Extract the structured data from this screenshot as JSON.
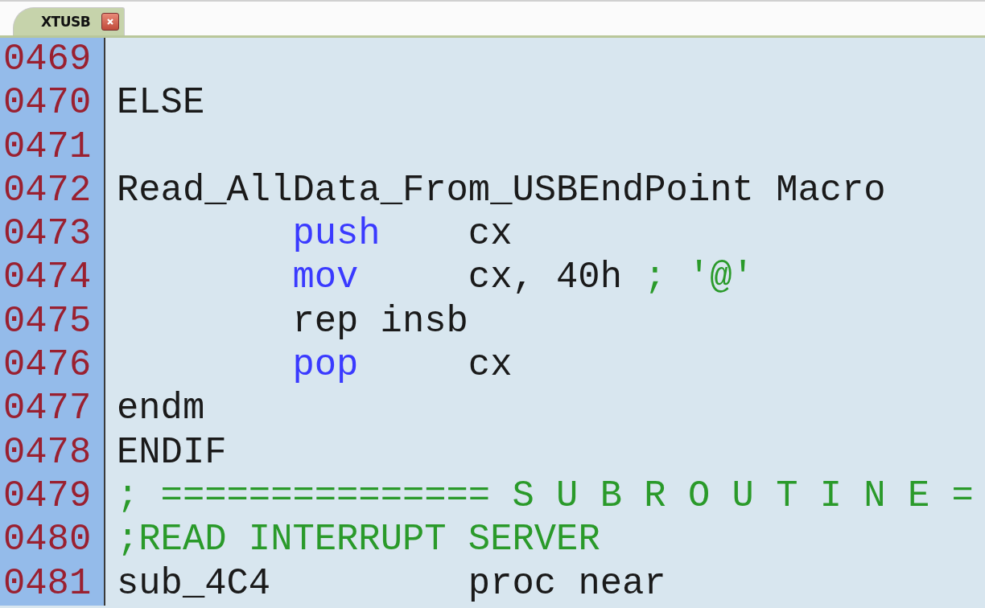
{
  "tabs": [
    {
      "label": "XTUSB",
      "selected": true
    }
  ],
  "lines": [
    {
      "number": "0469"
    },
    {
      "number": "0470",
      "indented": false,
      "segments": [
        {
          "kind": "plain",
          "text": "ELSE"
        }
      ]
    },
    {
      "number": "0471"
    },
    {
      "number": "0472",
      "indented": false,
      "segments": [
        {
          "kind": "plain",
          "text": "Read_AllData_From_USBEndPoint Macro"
        }
      ]
    },
    {
      "number": "0473",
      "indented": true,
      "segments": [
        {
          "kind": "keyword",
          "text": "push"
        },
        {
          "kind": "plain",
          "text": "    cx"
        }
      ]
    },
    {
      "number": "0474",
      "indented": true,
      "segments": [
        {
          "kind": "keyword",
          "text": "mov"
        },
        {
          "kind": "plain",
          "text": "     cx, 40h "
        },
        {
          "kind": "comment",
          "text": "; '@'"
        }
      ]
    },
    {
      "number": "0475",
      "indented": true,
      "segments": [
        {
          "kind": "plain",
          "text": "rep insb"
        }
      ]
    },
    {
      "number": "0476",
      "indented": true,
      "segments": [
        {
          "kind": "keyword",
          "text": "pop"
        },
        {
          "kind": "plain",
          "text": "     cx"
        }
      ]
    },
    {
      "number": "0477",
      "indented": false,
      "segments": [
        {
          "kind": "plain",
          "text": "endm"
        }
      ]
    },
    {
      "number": "0478",
      "indented": false,
      "segments": [
        {
          "kind": "plain",
          "text": "ENDIF"
        }
      ]
    },
    {
      "number": "0479",
      "indented": false,
      "segments": [
        {
          "kind": "comment",
          "text": "; =============== S U B R O U T I N E ="
        }
      ]
    },
    {
      "number": "0480",
      "indented": false,
      "segments": [
        {
          "kind": "comment",
          "text": ";READ INTERRUPT SERVER"
        }
      ]
    },
    {
      "number": "0481",
      "indented": false,
      "segments": [
        {
          "kind": "plain",
          "text": "sub_4C4         proc near"
        }
      ]
    }
  ]
}
